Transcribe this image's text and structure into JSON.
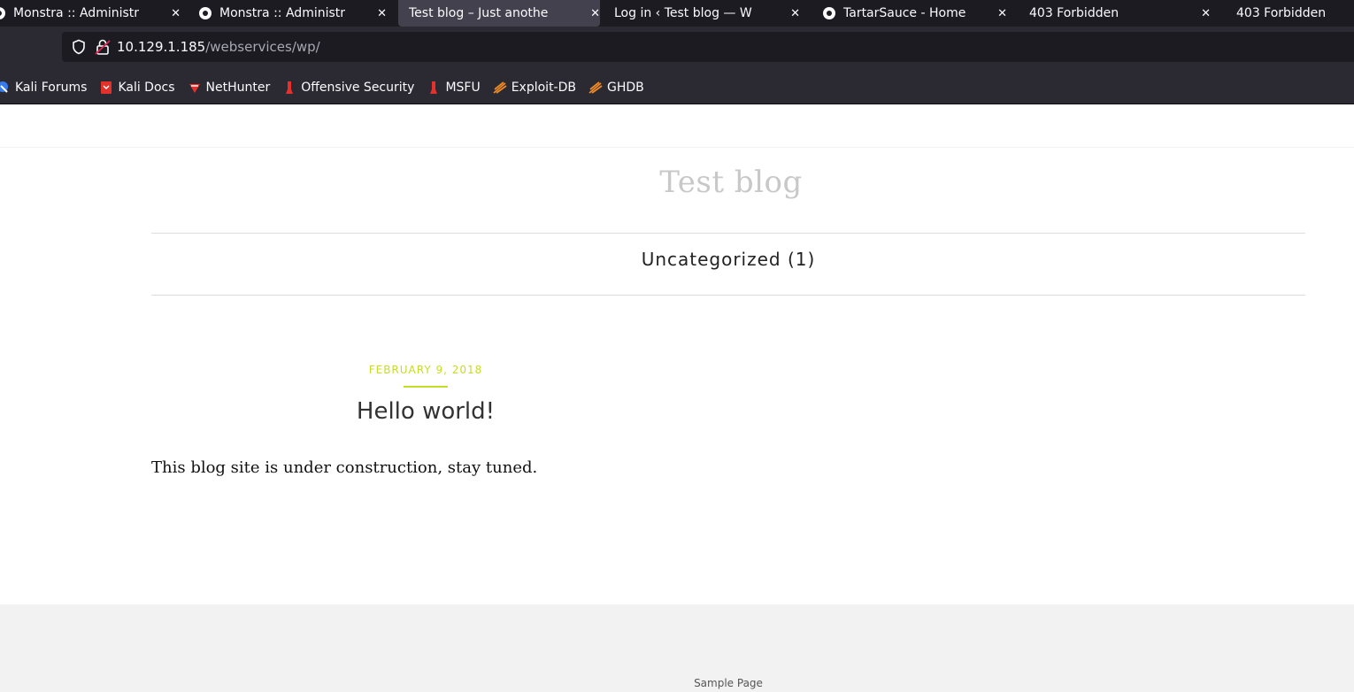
{
  "browser": {
    "tabs": [
      {
        "title": "Monstra :: Administr",
        "active": false
      },
      {
        "title": "Monstra :: Administr",
        "active": false
      },
      {
        "title": "Test blog – Just anothe",
        "active": true
      },
      {
        "title": "Log in ‹ Test blog — W",
        "active": false
      },
      {
        "title": "TartarSauce - Home",
        "active": false
      },
      {
        "title": "403 Forbidden",
        "active": false
      },
      {
        "title": "403 Forbidden",
        "active": false
      }
    ],
    "url": {
      "host": "10.129.1.185",
      "path": "/webservices/wp/"
    },
    "bookmarks": [
      {
        "label": "Kali Forums",
        "icon": "kali-forums-icon"
      },
      {
        "label": "Kali Docs",
        "icon": "kali-docs-icon"
      },
      {
        "label": "NetHunter",
        "icon": "nethunter-icon"
      },
      {
        "label": "Offensive Security",
        "icon": "offsec-icon"
      },
      {
        "label": "MSFU",
        "icon": "msfu-icon"
      },
      {
        "label": "Exploit-DB",
        "icon": "exploit-db-icon"
      },
      {
        "label": "GHDB",
        "icon": "ghdb-icon"
      }
    ]
  },
  "site": {
    "title": "Test blog",
    "category_link": "Uncategorized",
    "category_count": "(1)",
    "post": {
      "date": "FEBRUARY 9, 2018",
      "title": "Hello world!",
      "excerpt": "This blog site is under construction, stay tuned."
    },
    "footer_link": "Sample Page"
  },
  "colors": {
    "accent": "#c5dd25",
    "chrome_dark": "#1c1b22",
    "chrome": "#2b2a33"
  }
}
